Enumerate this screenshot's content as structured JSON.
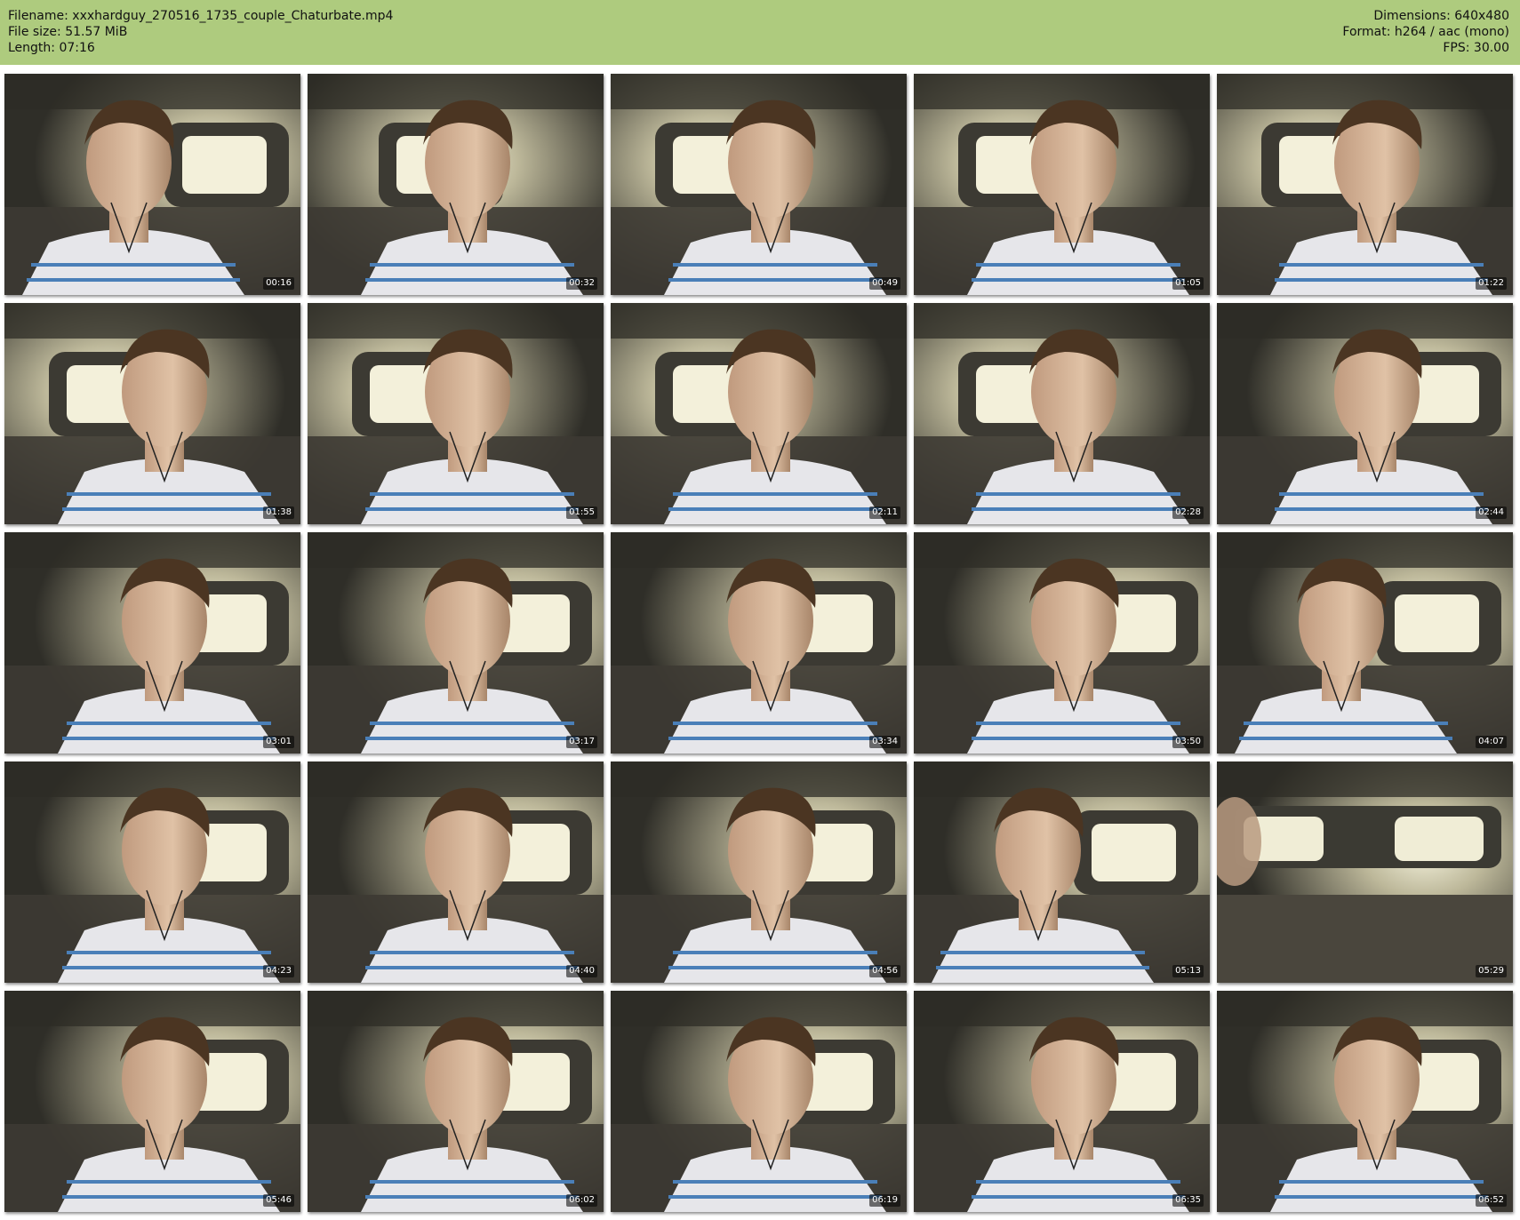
{
  "header": {
    "filename": "Filename: xxxhardguy_270516_1735_couple_Chaturbate.mp4",
    "filesize": "File size: 51.57 MiB",
    "length": "Length: 07:16",
    "dimensions": "Dimensions: 640x480",
    "format": "Format: h264 / aac (mono)",
    "fps": "FPS: 30.00"
  },
  "colors": {
    "header_bg": "#aecb7e",
    "page_bg": "#ffffff"
  },
  "thumbnails": [
    {
      "time": "00:16",
      "pose": "left",
      "window": "right"
    },
    {
      "time": "00:32",
      "pose": "front",
      "window": "center"
    },
    {
      "time": "00:49",
      "pose": "front",
      "window": "left"
    },
    {
      "time": "01:05",
      "pose": "front",
      "window": "left"
    },
    {
      "time": "01:22",
      "pose": "front",
      "window": "left"
    },
    {
      "time": "01:38",
      "pose": "front",
      "window": "left"
    },
    {
      "time": "01:55",
      "pose": "front",
      "window": "left"
    },
    {
      "time": "02:11",
      "pose": "front",
      "window": "left"
    },
    {
      "time": "02:28",
      "pose": "front",
      "window": "left"
    },
    {
      "time": "02:44",
      "pose": "front",
      "window": "right"
    },
    {
      "time": "03:01",
      "pose": "front",
      "window": "right"
    },
    {
      "time": "03:17",
      "pose": "front",
      "window": "right"
    },
    {
      "time": "03:34",
      "pose": "front",
      "window": "right"
    },
    {
      "time": "03:50",
      "pose": "front",
      "window": "right"
    },
    {
      "time": "04:07",
      "pose": "left",
      "window": "right"
    },
    {
      "time": "04:23",
      "pose": "front",
      "window": "right"
    },
    {
      "time": "04:40",
      "pose": "front",
      "window": "right"
    },
    {
      "time": "04:56",
      "pose": "front",
      "window": "right"
    },
    {
      "time": "05:13",
      "pose": "left",
      "window": "right"
    },
    {
      "time": "05:29",
      "pose": "none",
      "window": "wide"
    },
    {
      "time": "05:46",
      "pose": "front",
      "window": "right"
    },
    {
      "time": "06:02",
      "pose": "front",
      "window": "right"
    },
    {
      "time": "06:19",
      "pose": "front",
      "window": "right"
    },
    {
      "time": "06:35",
      "pose": "front",
      "window": "right"
    },
    {
      "time": "06:52",
      "pose": "front",
      "window": "right"
    }
  ]
}
